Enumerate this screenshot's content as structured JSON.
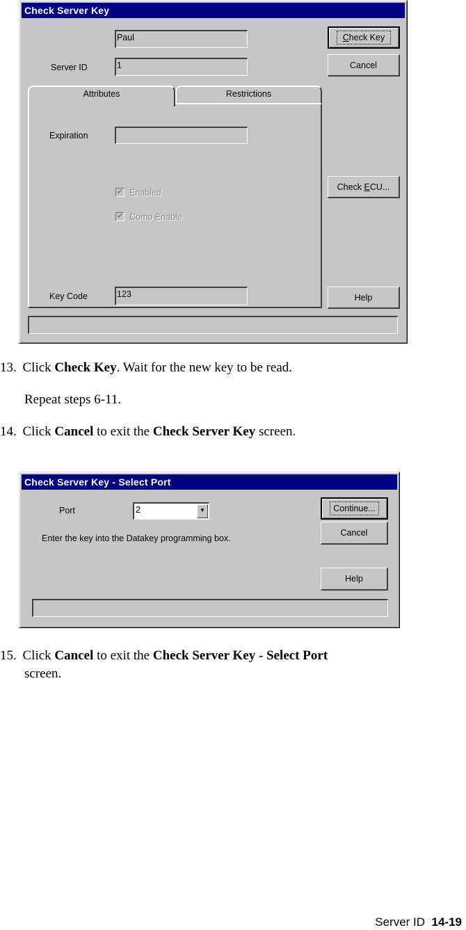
{
  "dialog1": {
    "title": "Check Server Key",
    "name_value": "Paul",
    "server_id_label": "Server ID",
    "server_id_value": "1",
    "tabs": [
      {
        "label": "Attributes",
        "active": true
      },
      {
        "label": "Restrictions",
        "active": false
      }
    ],
    "expiration_label": "Expiration",
    "expiration_value": "",
    "checkboxes": [
      {
        "label": "Enabled",
        "checked": true,
        "disabled": true
      },
      {
        "label": "Comp Enable",
        "checked": true,
        "disabled": true
      }
    ],
    "key_code_label": "Key Code",
    "key_code_value": "123",
    "buttons": {
      "check_key_mnemonic": "C",
      "check_key_rest": "heck Key",
      "cancel": "Cancel",
      "check_ecu_prefix": "Check ",
      "check_ecu_mnemonic": "E",
      "check_ecu_rest": "CU...",
      "help": "Help"
    },
    "status_text": ""
  },
  "steps_a": {
    "step13": {
      "num": "13.",
      "pre": "Click ",
      "bold": "Check Key",
      "post": ". Wait for the new key to be read."
    },
    "repeat": "Repeat steps 6-11.",
    "step14": {
      "num": "14.",
      "pre": "Click ",
      "bold1": "Cancel",
      "mid": " to exit the ",
      "bold2": "Check Server Key",
      "post": " screen."
    }
  },
  "dialog2": {
    "title": "Check Server Key - Select Port",
    "port_label": "Port",
    "port_value": "2",
    "instruction": "Enter the key into the Datakey programming box.",
    "buttons": {
      "continue": "Continue...",
      "cancel": "Cancel",
      "help": "Help"
    },
    "status_text": ""
  },
  "steps_b": {
    "step15": {
      "num": "15.",
      "pre": "Click ",
      "bold1": "Cancel",
      "mid": " to exit the ",
      "bold2": "Check Server Key - Select Port",
      "post": "",
      "line2": "screen."
    }
  },
  "footer": {
    "section": "Server ID",
    "page": "14-19"
  }
}
